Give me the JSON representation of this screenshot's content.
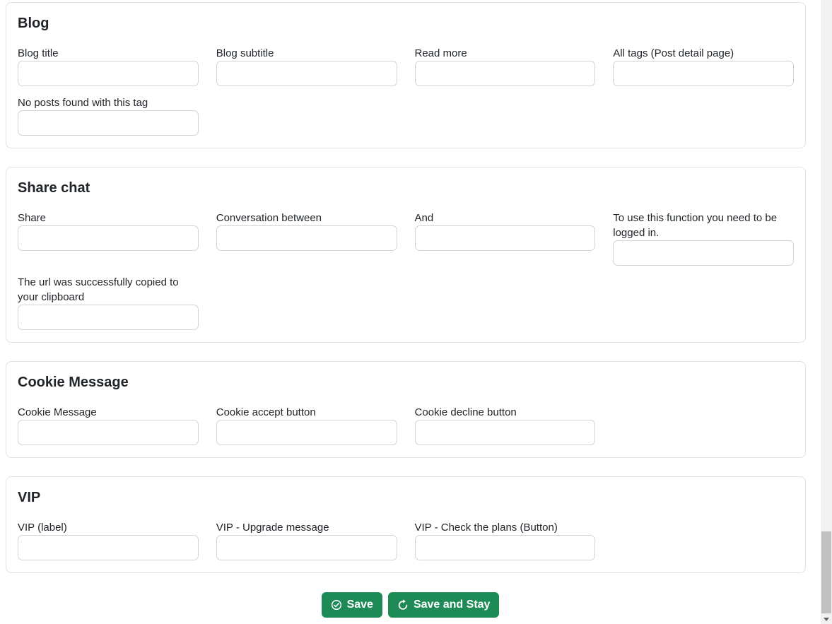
{
  "theme": {
    "button_green": "#1e8a56",
    "card_border": "#dee2e6",
    "input_border": "#ced4da",
    "text_color": "#212529",
    "scrollbar_track": "#f1f1f1",
    "scrollbar_thumb": "#c1c1c1"
  },
  "sections": [
    {
      "id": "blog",
      "title": "Blog",
      "fields": [
        {
          "label": "Blog title",
          "value": ""
        },
        {
          "label": "Blog subtitle",
          "value": ""
        },
        {
          "label": "Read more",
          "value": ""
        },
        {
          "label": "All tags (Post detail page)",
          "value": ""
        },
        {
          "label": "No posts found with this tag",
          "value": ""
        }
      ]
    },
    {
      "id": "share-chat",
      "title": "Share chat",
      "fields": [
        {
          "label": "Share",
          "value": ""
        },
        {
          "label": "Conversation between",
          "value": ""
        },
        {
          "label": "And",
          "value": ""
        },
        {
          "label": "To use this function you need to be logged in.",
          "value": ""
        },
        {
          "label": "The url was successfully copied to your clipboard",
          "value": ""
        }
      ]
    },
    {
      "id": "cookie-message",
      "title": "Cookie Message",
      "fields": [
        {
          "label": "Cookie Message",
          "value": ""
        },
        {
          "label": "Cookie accept button",
          "value": ""
        },
        {
          "label": "Cookie decline button",
          "value": ""
        }
      ]
    },
    {
      "id": "vip",
      "title": "VIP",
      "fields": [
        {
          "label": "VIP (label)",
          "value": ""
        },
        {
          "label": "VIP - Upgrade message",
          "value": ""
        },
        {
          "label": "VIP - Check the plans (Button)",
          "value": ""
        }
      ]
    }
  ],
  "actions": {
    "save_label": "Save",
    "save_and_stay_label": "Save and Stay",
    "save_icon": "check-circle-icon",
    "save_and_stay_icon": "arrow-clockwise-icon"
  }
}
